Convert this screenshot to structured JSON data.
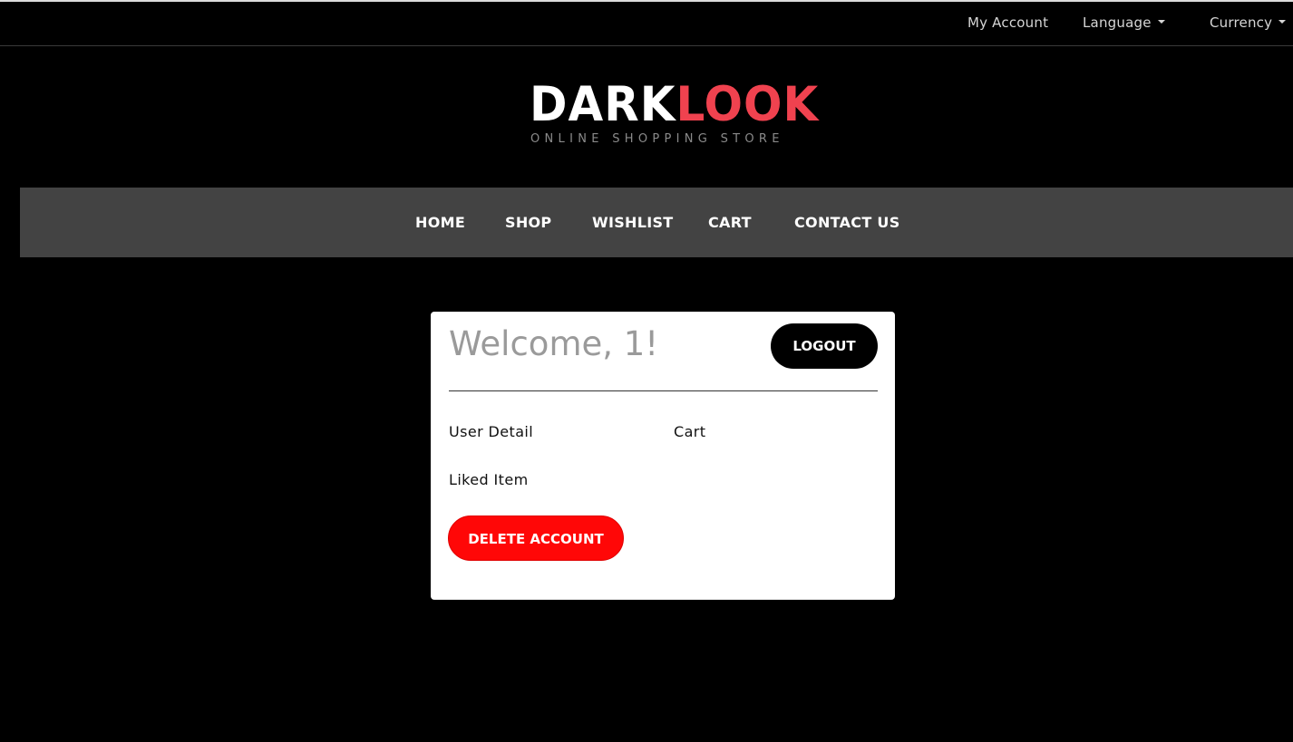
{
  "topbar": {
    "my_account": "My Account",
    "language": "Language",
    "currency": "Currency"
  },
  "logo": {
    "word_dark": "DARK",
    "word_look": "LOOK",
    "tagline": "ONLINE SHOPPING STORE"
  },
  "nav": {
    "items": [
      "HOME",
      "SHOP",
      "WISHLIST",
      "CART",
      "CONTACT US"
    ]
  },
  "account_card": {
    "welcome": "Welcome, 1!",
    "logout_label": "LOGOUT",
    "links": {
      "user_detail": "User Detail",
      "cart": "Cart",
      "liked_item": "Liked Item"
    },
    "delete_label": "DELETE ACCOUNT"
  },
  "colors": {
    "background": "#000000",
    "navbar": "#434343",
    "logo_accent": "#f0424f",
    "delete_button": "#ff0707"
  }
}
